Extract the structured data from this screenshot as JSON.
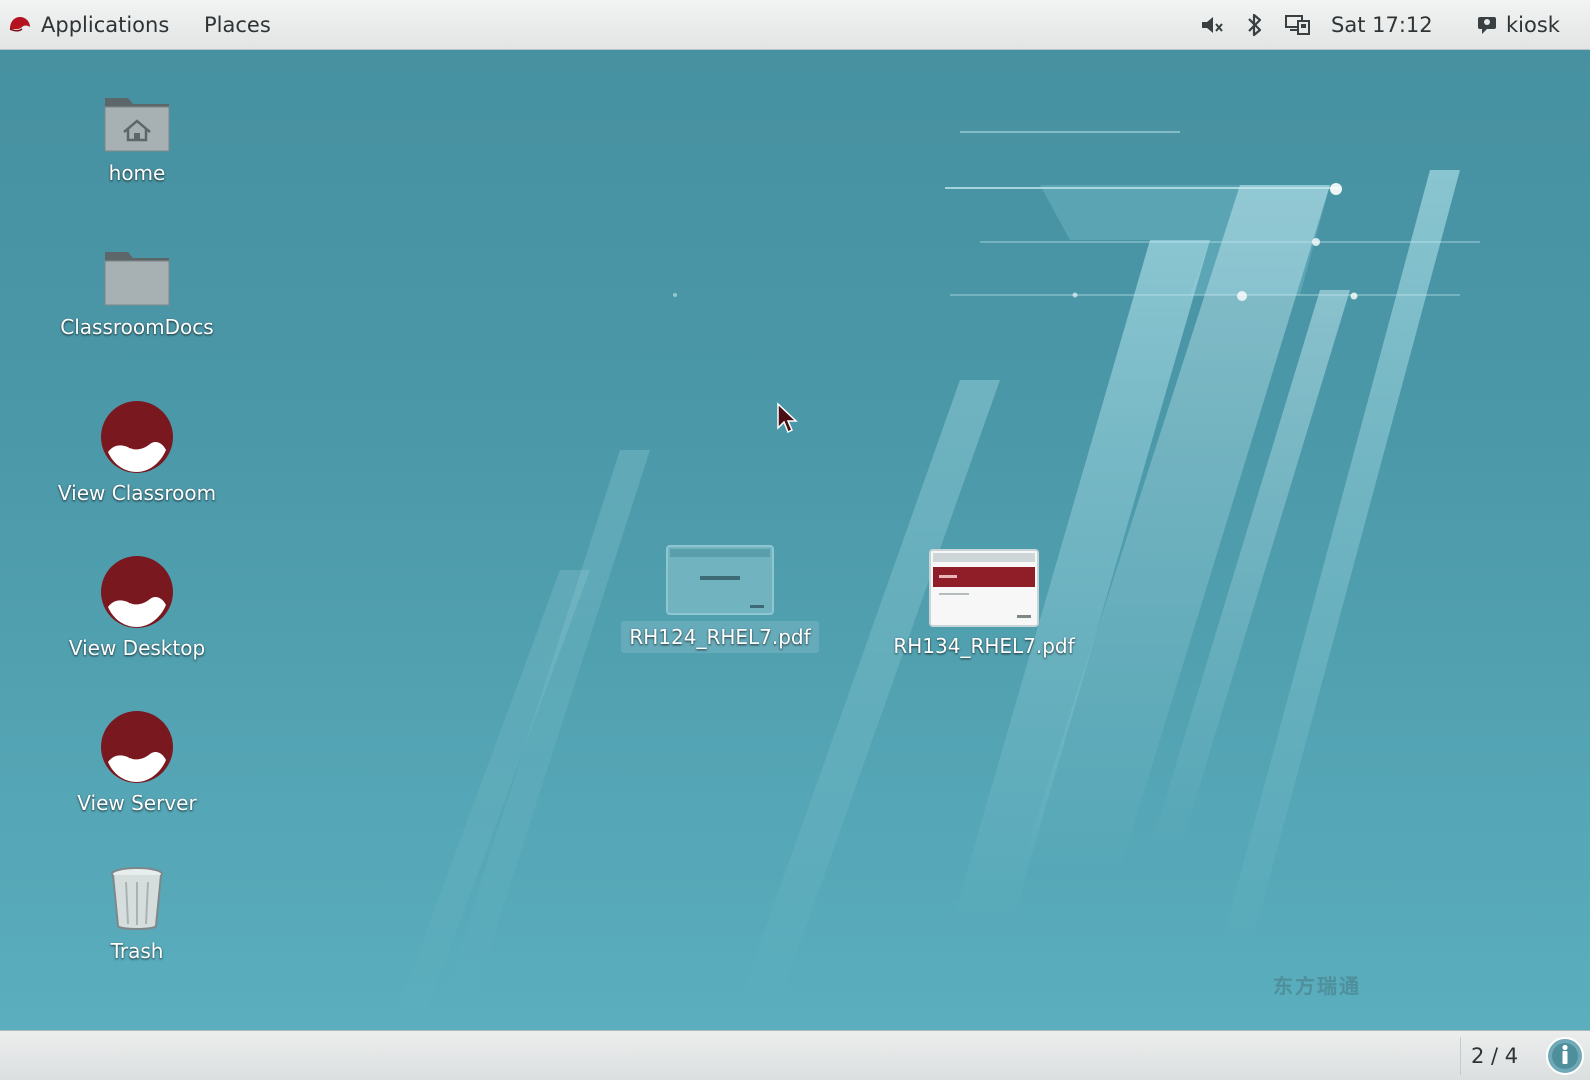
{
  "topbar": {
    "applications_label": "Applications",
    "places_label": "Places",
    "clock": "Sat 17:12",
    "user": "kiosk",
    "status_icons": [
      "volume-muted-icon",
      "bluetooth-icon",
      "network-icon"
    ]
  },
  "desktop": {
    "icons": [
      {
        "label": "home",
        "icon": "home-folder-icon"
      },
      {
        "label": "ClassroomDocs",
        "icon": "folder-icon"
      },
      {
        "label": "View Classroom",
        "icon": "redhat-icon"
      },
      {
        "label": "View Desktop",
        "icon": "redhat-icon"
      },
      {
        "label": "View Server",
        "icon": "redhat-icon"
      },
      {
        "label": "Trash",
        "icon": "trash-icon"
      }
    ],
    "files": [
      {
        "label": "RH124_RHEL7.pdf",
        "icon": "pdf-thumbnail-icon"
      },
      {
        "label": "RH134_RHEL7.pdf",
        "icon": "pdf-thumbnail-icon"
      }
    ]
  },
  "watermark": "东方瑞通",
  "bottombar": {
    "workspace": "2 / 4"
  },
  "colors": {
    "wallpaper": "#4b98a8",
    "panel": "#e8eaea",
    "redhat": "#7a1820"
  }
}
